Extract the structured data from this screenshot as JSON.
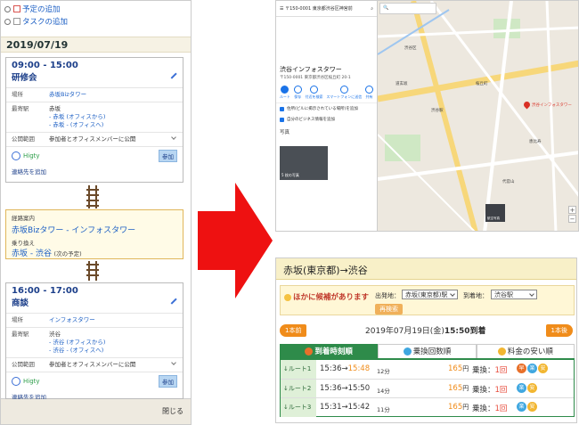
{
  "left_panel": {
    "add_schedule": "予定の追加",
    "add_task": "タスクの追加",
    "date": "2019/07/19",
    "event1": {
      "time": "09:00 - 15:00",
      "name": "研修会",
      "place_label": "場所",
      "place": "赤坂Bizタワー",
      "station_label": "最寄駅",
      "station": "赤坂",
      "station_line1": "- 赤坂 (オフィスから)",
      "station_line2": "- 赤坂 - (オフィスへ)",
      "scope_label": "公開範囲",
      "scope": "参加者とオフィスメンバーに公開",
      "user": "Higty",
      "join": "参加",
      "contact": "連絡先を追加"
    },
    "route_box": {
      "label": "経路案内",
      "route": "赤坂Bizタワー - インフォスタワー",
      "transfer_label": "乗り換え",
      "transfer": "赤坂 - 渋谷",
      "transfer_note": "(次の予定)"
    },
    "event2": {
      "time": "16:00 - 17:00",
      "name": "商談",
      "place_label": "場所",
      "place": "インフォスタワー",
      "station_label": "最寄駅",
      "station": "渋谷",
      "station_line1": "- 渋谷 (オフィスから)",
      "station_line2": "- 渋谷 - (オフィスへ)",
      "scope_label": "公開範囲",
      "scope": "参加者とオフィスメンバーに公開",
      "user": "Higty",
      "join": "参加",
      "contact": "連絡先を追加"
    },
    "close": "閉じる"
  },
  "map": {
    "address_bar": "〒150-0001 東京都渋谷区神宮前",
    "place_name": "渋谷インフォスタワー",
    "place_address": "〒150-0001 東京都渋谷区桜丘町 20-1",
    "actions": [
      "ルート",
      "保存",
      "付近を検索",
      "スマートフォンに送信",
      "共有"
    ],
    "info_lines": [
      "住所(ビルに掲示されている場所)を追加",
      "自分のビジネス情報を追加"
    ],
    "photos_label": "写真",
    "photo_caption": "5 枚の写真",
    "pin_label": "渋谷インフォスタワー",
    "map_labels": [
      "渋谷区",
      "渋谷駅",
      "代官山",
      "恵比寿",
      "桜丘町",
      "道玄坂"
    ],
    "thumb_caption": "航空写真"
  },
  "transit": {
    "title": "赤坂(東京都)→渋谷",
    "candidate_notice": "ほかに候補があります",
    "from_label": "出発地：",
    "from_value": "赤坂(東京都)駅",
    "to_label": "到着地：",
    "to_value": "渋谷駅",
    "research": "再検索",
    "prev": "1本前",
    "next": "1本後",
    "date_prefix": "2019年07月19日(金)",
    "date_arrival": "15:50到着",
    "tabs": [
      "到着時刻順",
      "乗換回数順",
      "料金の安い順"
    ],
    "routes": [
      {
        "label": "↓ルート1",
        "dep": "15:36",
        "arr": "15:48",
        "dur": "12分",
        "fare": "165",
        "yen": "円",
        "xfer_label": "乗換：",
        "xfer": "1回"
      },
      {
        "label": "↓ルート2",
        "dep": "15:36",
        "arr": "15:50",
        "dur": "14分",
        "fare": "165",
        "yen": "円",
        "xfer_label": "乗換：",
        "xfer": "1回"
      },
      {
        "label": "↓ルート3",
        "dep": "15:31",
        "arr": "15:42",
        "dur": "11分",
        "fare": "165",
        "yen": "円",
        "xfer_label": "乗換：",
        "xfer": "1回"
      }
    ],
    "badge_early": "早",
    "badge_easy": "楽",
    "badge_cheap": "安",
    "colors": {
      "early": "#e8702a",
      "easy": "#3fa7e0",
      "cheap": "#f2b631",
      "green": "#2e8b4a",
      "orange": "#f08c1a"
    }
  }
}
